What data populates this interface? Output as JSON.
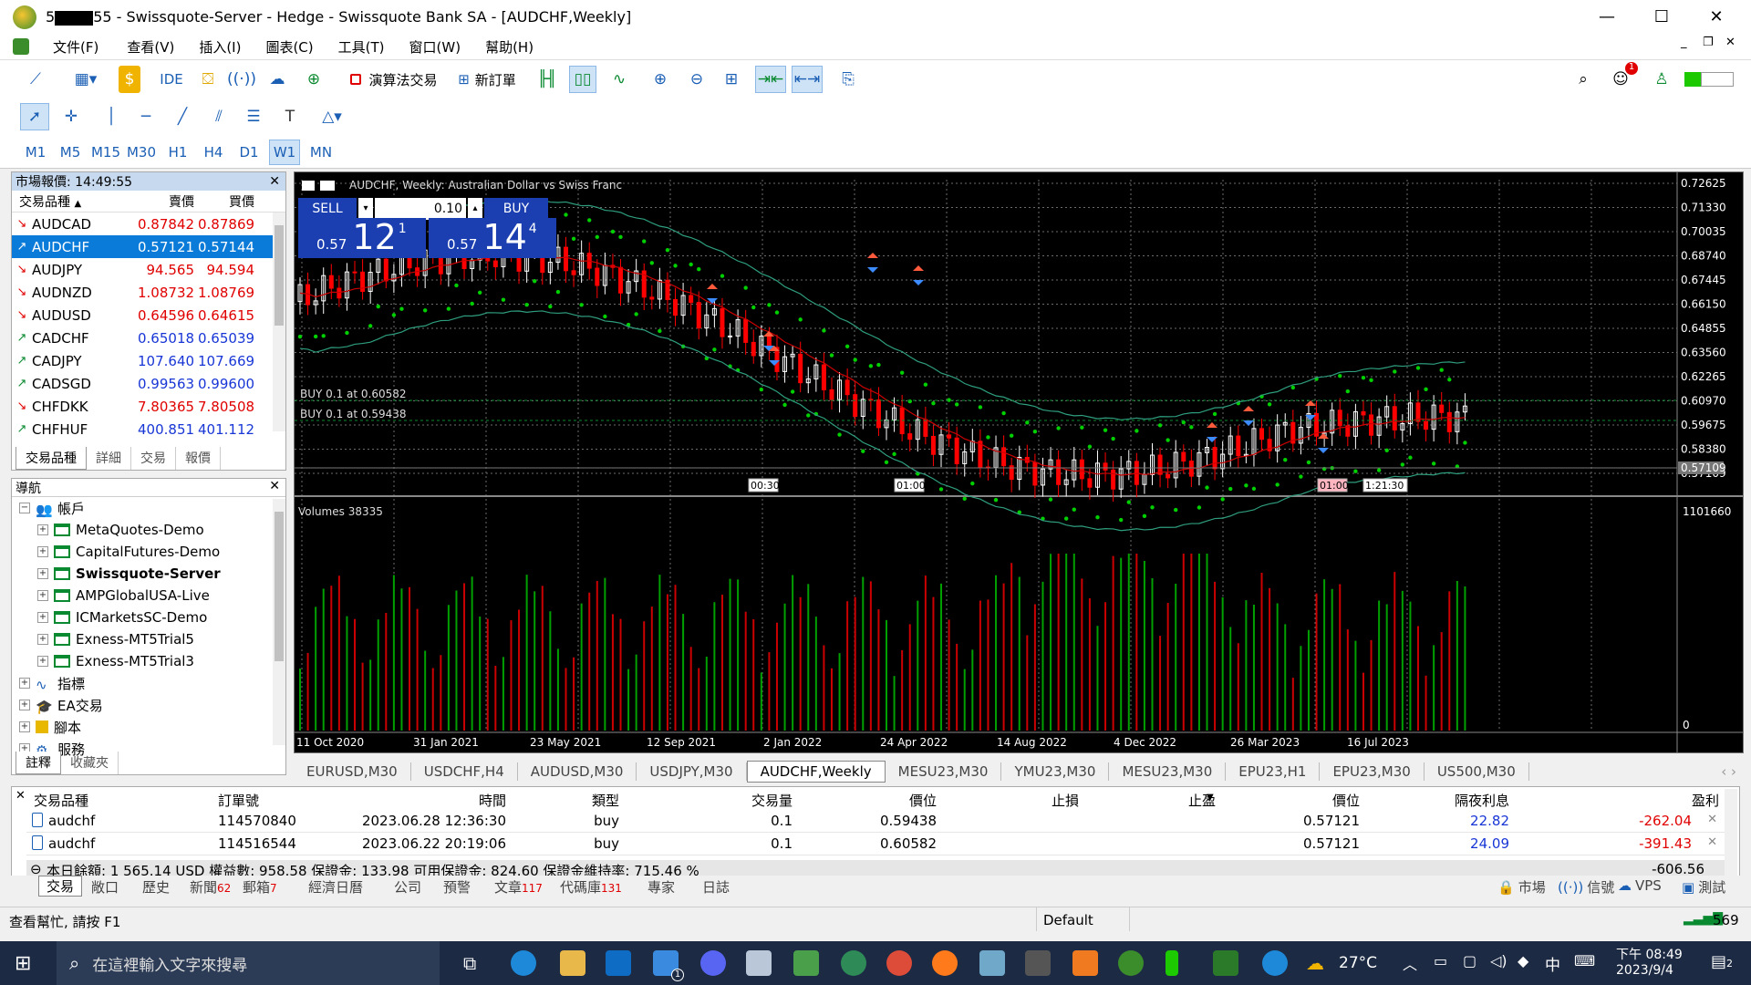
{
  "window": {
    "title_prefix": "5",
    "title_suffix": "55 - Swissquote-Server - Hedge - Swissquote Bank SA - [AUDCHF,Weekly]",
    "minimize": "—",
    "maximize": "☐",
    "close": "✕"
  },
  "menu": [
    "文件(F)",
    "查看(V)",
    "插入(I)",
    "圖表(C)",
    "工具(T)",
    "窗口(W)",
    "幫助(H)"
  ],
  "mdi": {
    "min": "_",
    "restore": "❐",
    "close": "✕"
  },
  "toolbar": {
    "ide": "IDE",
    "algo": "演算法交易",
    "new_order": "新訂單",
    "notif_count": "1"
  },
  "timeframes": [
    "M1",
    "M5",
    "M15",
    "M30",
    "H1",
    "H4",
    "D1",
    "W1",
    "MN"
  ],
  "selected_timeframe": "W1",
  "market_watch": {
    "header": "市場報價: 14:49:55",
    "col_symbol": "交易品種",
    "col_bid": "賣價",
    "col_ask": "買價",
    "rows": [
      {
        "dir": "↘",
        "symbol": "AUDCAD",
        "bid": "0.87842",
        "ask": "0.87869",
        "color": "red"
      },
      {
        "dir": "↗",
        "symbol": "AUDCHF",
        "bid": "0.57121",
        "ask": "0.57144",
        "color": "sel"
      },
      {
        "dir": "↘",
        "symbol": "AUDJPY",
        "bid": "94.565",
        "ask": "94.594",
        "color": "red"
      },
      {
        "dir": "↘",
        "symbol": "AUDNZD",
        "bid": "1.08732",
        "ask": "1.08769",
        "color": "red"
      },
      {
        "dir": "↘",
        "symbol": "AUDUSD",
        "bid": "0.64596",
        "ask": "0.64615",
        "color": "red"
      },
      {
        "dir": "↗",
        "symbol": "CADCHF",
        "bid": "0.65018",
        "ask": "0.65039",
        "color": "blue"
      },
      {
        "dir": "↗",
        "symbol": "CADJPY",
        "bid": "107.640",
        "ask": "107.669",
        "color": "blue"
      },
      {
        "dir": "↗",
        "symbol": "CADSGD",
        "bid": "0.99563",
        "ask": "0.99600",
        "color": "blue"
      },
      {
        "dir": "↘",
        "symbol": "CHFDKK",
        "bid": "7.80365",
        "ask": "7.80508",
        "color": "red"
      },
      {
        "dir": "↗",
        "symbol": "CHFHUF",
        "bid": "400.851",
        "ask": "401.112",
        "color": "blue"
      }
    ],
    "tabs": [
      "交易品種",
      "詳細",
      "交易",
      "報價"
    ]
  },
  "navigator": {
    "header": "導航",
    "accounts_label": "帳戶",
    "accounts": [
      "MetaQuotes-Demo",
      "CapitalFutures-Demo",
      "Swissquote-Server",
      "AMPGlobalUSA-Live",
      "ICMarketsSC-Demo",
      "Exness-MT5Trial5",
      "Exness-MT5Trial3"
    ],
    "active_account": "Swissquote-Server",
    "sections": [
      "指標",
      "EA交易",
      "腳本",
      "服務"
    ],
    "tabs": [
      "註釋",
      "收藏夾"
    ]
  },
  "chart": {
    "title": "AUDCHF, Weekly:  Australian Dollar vs Swiss Franc",
    "sell_label": "SELL",
    "buy_label": "BUY",
    "lot": "0.10",
    "sell_price_small": "0.57",
    "sell_price_big": "12",
    "sell_price_sup": "1",
    "buy_price_small": "0.57",
    "buy_price_big": "14",
    "buy_price_sup": "4",
    "price_axis": [
      "0.72625",
      "0.71330",
      "0.70035",
      "0.68740",
      "0.67445",
      "0.66150",
      "0.64855",
      "0.63560",
      "0.62265",
      "0.60970",
      "0.59675",
      "0.58380",
      "0.57109"
    ],
    "current_price": "0.57109",
    "order_lines": [
      "BUY 0.1 at 0.60582",
      "BUY 0.1 at 0.59438"
    ],
    "time_markers": [
      "00:30",
      "01:00",
      "01:00",
      "1:21:30"
    ],
    "volume_label": "Volumes 38335",
    "volume_axis_top": "1101660",
    "volume_axis_bottom": "0",
    "date_axis": [
      "11 Oct 2020",
      "31 Jan 2021",
      "23 May 2021",
      "12 Sep 2021",
      "2 Jan 2022",
      "24 Apr 2022",
      "14 Aug 2022",
      "4 Dec 2022",
      "26 Mar 2023",
      "16 Jul 2023"
    ],
    "colors": {
      "bull": "#ffffff",
      "bear": "#ff0000",
      "ma": "#cc0000",
      "bands": "#2e9e7e",
      "sar": "#00d000",
      "volume_up": "#00a000",
      "volume_down": "#cc0000",
      "grid": "#6b6b6b"
    }
  },
  "chart_tabs": [
    "EURUSD,M30",
    "USDCHF,H4",
    "AUDUSD,M30",
    "USDJPY,M30",
    "AUDCHF,Weekly",
    "MESU23,M30",
    "YMU23,M30",
    "MESU23,M30",
    "EPU23,H1",
    "EPU23,M30",
    "US500,M30"
  ],
  "active_chart_tab": "AUDCHF,Weekly",
  "toolbox": {
    "headers": [
      "交易品種",
      "訂單號",
      "時間",
      "類型",
      "交易量",
      "價位",
      "止損",
      "止盈",
      "價位",
      "隔夜利息",
      "盈利"
    ],
    "rows": [
      {
        "symbol": "audchf",
        "ticket": "114570840",
        "time": "2023.06.28 12:36:30",
        "type": "buy",
        "volume": "0.1",
        "price": "0.59438",
        "sl": "",
        "tp": "",
        "cur": "0.57121",
        "swap": "22.82",
        "profit": "-262.04"
      },
      {
        "symbol": "audchf",
        "ticket": "114516544",
        "time": "2023.06.22 20:19:06",
        "type": "buy",
        "volume": "0.1",
        "price": "0.60582",
        "sl": "",
        "tp": "",
        "cur": "0.57121",
        "swap": "24.09",
        "profit": "-391.43"
      }
    ],
    "summary": "本日餘額: 1 565.14 USD  權益數: 958.58  保證金: 133.98  可用保證金: 824.60  保證金維持率: 715.46 %",
    "total_profit": "-606.56",
    "tabs": [
      {
        "label": "交易",
        "badge": ""
      },
      {
        "label": "敞口",
        "badge": ""
      },
      {
        "label": "歷史",
        "badge": ""
      },
      {
        "label": "新聞",
        "badge": "62"
      },
      {
        "label": "郵箱",
        "badge": "7"
      },
      {
        "label": "經濟日曆",
        "badge": ""
      },
      {
        "label": "公司",
        "badge": ""
      },
      {
        "label": "預警",
        "badge": ""
      },
      {
        "label": "文章",
        "badge": "117"
      },
      {
        "label": "代碼庫",
        "badge": "131"
      },
      {
        "label": "專家",
        "badge": ""
      },
      {
        "label": "日誌",
        "badge": ""
      }
    ],
    "right_tabs": [
      "市場",
      "信號",
      "VPS",
      "測試"
    ]
  },
  "status": {
    "help": "查看幫忙, 請按 F1",
    "profile": "Default",
    "ping": "569"
  },
  "taskbar": {
    "search_placeholder": "在這裡輸入文字來搜尋",
    "temperature": "27°C",
    "ime": "中",
    "time": "下午 08:49",
    "date": "2023/9/4",
    "notif_count": "2",
    "mail_badge": "1"
  }
}
